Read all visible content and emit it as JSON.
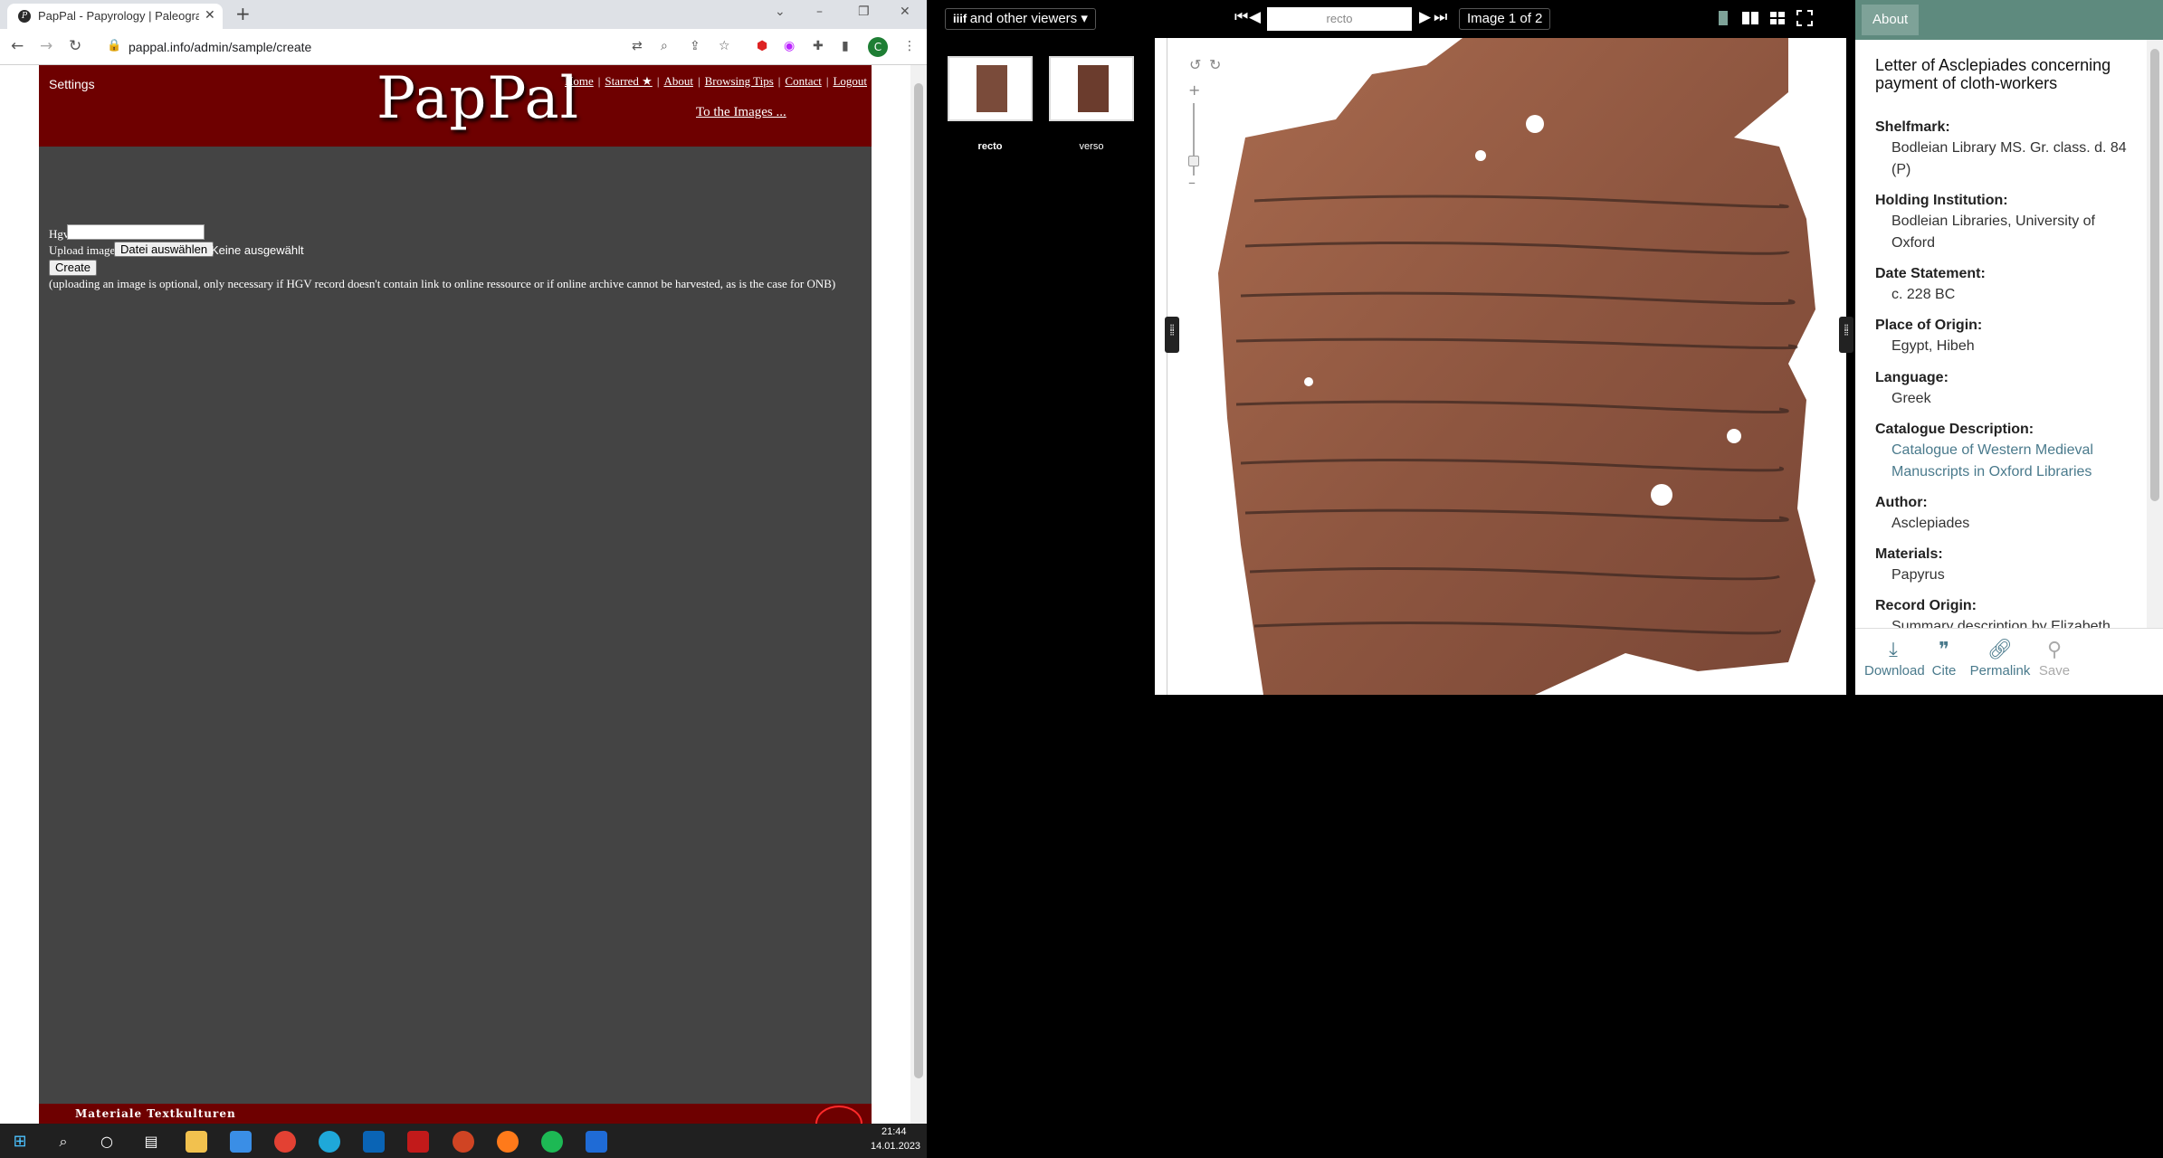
{
  "browser": {
    "tab_title": "PapPal - Papyrology | Paleography",
    "url": "pappal.info/admin/sample/create"
  },
  "site": {
    "settings_label": "Settings",
    "logo": "PapPal",
    "nav": [
      "Home",
      "Starred ★",
      "About",
      "Browsing Tips",
      "Contact",
      "Logout"
    ],
    "to_images": "To the Images ...",
    "form": {
      "hgv_label": "Hgv",
      "hgv_value": "",
      "upload_label": "Upload image",
      "file_button": "Datei auswählen",
      "file_status": "Keine ausgewählt",
      "create_button": "Create",
      "note": "(uploading an image is optional, only necessary if HGV record doesn't contain link to online ressource or if online archive cannot be harvested, as is the case for ONB)"
    },
    "footer_text": "Materiale Textkulturen"
  },
  "taskbar": {
    "time": "21:44",
    "date": "14.01.2023"
  },
  "viewer": {
    "viewers_dropdown": "and other viewers",
    "page_input": "recto",
    "image_counter": "Image 1 of 2",
    "thumbnails": [
      "recto",
      "verso"
    ],
    "about_tab": "About",
    "title": "Letter of Asclepiades concerning payment of cloth-workers",
    "metadata": [
      {
        "label": "Shelfmark:",
        "value": "Bodleian Library MS. Gr. class. d. 84 (P)"
      },
      {
        "label": "Holding Institution:",
        "value": "Bodleian Libraries, University of Oxford"
      },
      {
        "label": "Date Statement:",
        "value": "c. 228 BC"
      },
      {
        "label": "Place of Origin:",
        "value": "Egypt, Hibeh"
      },
      {
        "label": "Language:",
        "value": "Greek"
      },
      {
        "label": "Catalogue Description:",
        "value": "Catalogue of Western Medieval Manuscripts in Oxford Libraries"
      },
      {
        "label": "Author:",
        "value": "Asclepiades"
      },
      {
        "label": "Materials:",
        "value": "Papyrus"
      },
      {
        "label": "Record Origin:",
        "value": "Summary description by Elizabeth"
      }
    ],
    "actions": [
      "Download",
      "Cite",
      "Permalink",
      "Save"
    ]
  }
}
